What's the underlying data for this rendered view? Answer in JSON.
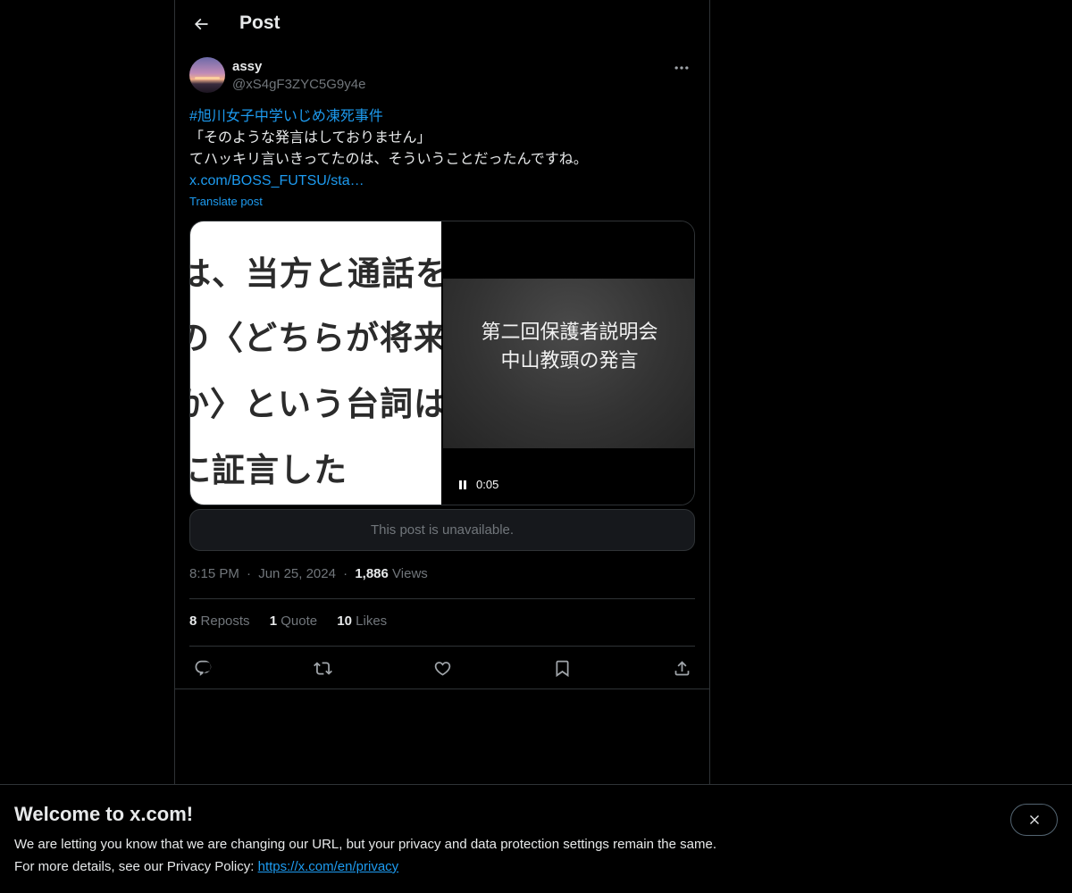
{
  "header": {
    "title": "Post",
    "back_icon": "arrow-left-icon"
  },
  "author": {
    "name": "assy",
    "handle": "@xS4gF3ZYC5G9y4e",
    "more_icon": "more-horizontal-icon"
  },
  "post": {
    "hashtag": "#旭川女子中学いじめ凍死事件",
    "line2": "「そのような発言はしておりません」",
    "line3": "てハッキリ言いきってたのは、そういうことだったんですね。",
    "link": "x.com/BOSS_FUTSU/sta…",
    "translate": "Translate post"
  },
  "media": {
    "image_lines": [
      "は、当方と通話をし",
      "の〈どちらが将来の",
      "か〉という台詞は、",
      "に証言した"
    ],
    "video_caption_line1": "第二回保護者説明会",
    "video_caption_line2": "中山教頭の発言",
    "video_time": "0:05",
    "pause_icon": "pause-icon"
  },
  "quoted": {
    "text": "This post is unavailable."
  },
  "meta": {
    "time": "8:15 PM",
    "date": "Jun 25, 2024",
    "views_count": "1,886",
    "views_label": "Views",
    "sep": "·"
  },
  "stats": {
    "reposts_count": "8",
    "reposts_label": "Reposts",
    "quotes_count": "1",
    "quotes_label": "Quote",
    "likes_count": "10",
    "likes_label": "Likes"
  },
  "actions": [
    "reply-icon",
    "repost-icon",
    "like-icon",
    "bookmark-icon",
    "share-icon"
  ],
  "banner": {
    "title": "Welcome to x.com!",
    "line1": "We are letting you know that we are changing our URL, but your privacy and data protection settings remain the same.",
    "line2_prefix": "For more details, see our Privacy Policy:",
    "link": "https://x.com/en/privacy",
    "close_icon": "close-icon"
  },
  "colors": {
    "accent": "#1d9bf0",
    "background": "#000000",
    "border": "#2f3336",
    "muted": "#71767b",
    "text": "#e7e9ea"
  }
}
